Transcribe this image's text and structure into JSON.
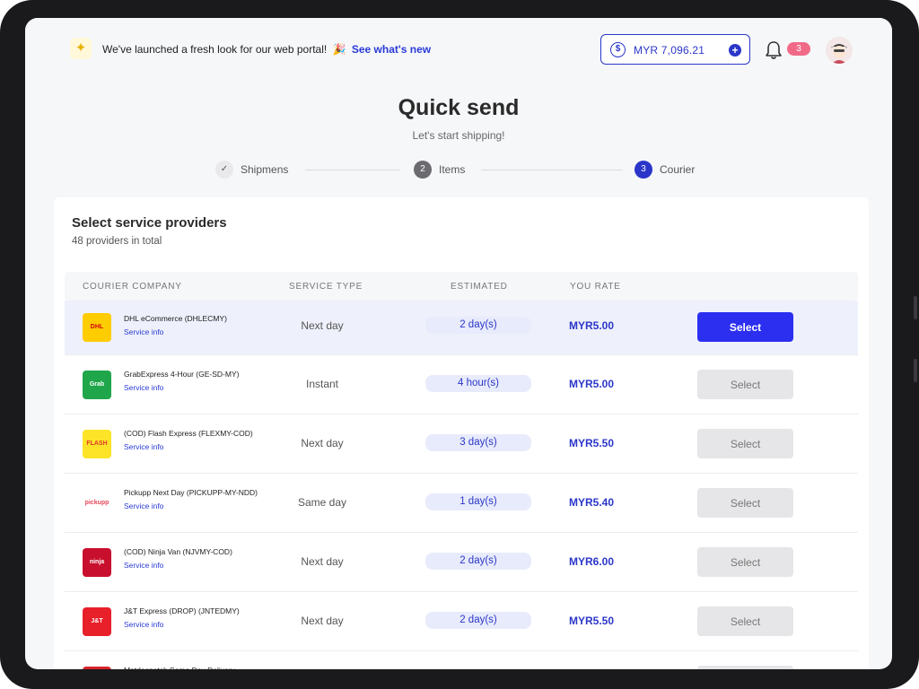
{
  "announcement": {
    "text": "We've launched a fresh look for our web portal!",
    "emoji": "🎉",
    "link": "See what's new"
  },
  "wallet": {
    "balance": "MYR 7,096.21"
  },
  "notifications": {
    "count": "3"
  },
  "page": {
    "title": "Quick send",
    "subtitle": "Let's start shipping!"
  },
  "steps": [
    {
      "label": "Shipmens",
      "marker": "✓",
      "state": "done"
    },
    {
      "label": "Items",
      "marker": "2",
      "state": "pending"
    },
    {
      "label": "Courier",
      "marker": "3",
      "state": "active"
    }
  ],
  "providers_card": {
    "title": "Select service providers",
    "count_text": "48 providers in total"
  },
  "table": {
    "headers": [
      "COURIER COMPANY",
      "SERVICE TYPE",
      "ESTIMATED",
      "YOU RATE"
    ],
    "service_info_label": "Service info",
    "select_label": "Select",
    "rows": [
      {
        "name": "DHL eCommerce (DHLECMY)",
        "logo_text": "DHL",
        "logo_bg": "#ffcc00",
        "logo_fg": "#d40511",
        "service": "Next day",
        "estimated": "2 day(s)",
        "rate": "MYR5.00",
        "selected": true
      },
      {
        "name": "GrabExpress 4-Hour (GE-SD-MY)",
        "logo_text": "Grab Express",
        "logo_bg": "#1fa64a",
        "logo_fg": "#ffffff",
        "service": "Instant",
        "estimated": "4 hour(s)",
        "rate": "MYR5.00",
        "selected": false
      },
      {
        "name": "(COD) Flash Express (FLEXMY-COD)",
        "logo_text": "FLASH",
        "logo_bg": "#fde428",
        "logo_fg": "#e03a2a",
        "service": "Next day",
        "estimated": "3 day(s)",
        "rate": "MYR5.50",
        "selected": false
      },
      {
        "name": "Pickupp Next Day (PICKUPP-MY-NDD)",
        "logo_text": "pickupp",
        "logo_bg": "#ffffff",
        "logo_fg": "#e5495b",
        "service": "Same day",
        "estimated": "1 day(s)",
        "rate": "MYR5.40",
        "selected": false
      },
      {
        "name": "(COD) Ninja Van (NJVMY-COD)",
        "logo_text": "ninja",
        "logo_bg": "#c8102e",
        "logo_fg": "#ffffff",
        "service": "Next day",
        "estimated": "2 day(s)",
        "rate": "MYR6.00",
        "selected": false
      },
      {
        "name": "J&T Express (DROP) (JNTEDMY)",
        "logo_text": "J&T",
        "logo_bg": "#e8202a",
        "logo_fg": "#ffffff",
        "service": "Next day",
        "estimated": "2 day(s)",
        "rate": "MYR5.50",
        "selected": false
      },
      {
        "name": "Matdespatch Same Day Delivery",
        "logo_text": "",
        "logo_bg": "#d8232a",
        "logo_fg": "#ffffff",
        "service": "",
        "estimated": "",
        "rate": "",
        "selected": false
      }
    ]
  },
  "colors": {
    "accent": "#2b36c9",
    "select_active": "#2c2ff0",
    "badge": "#f06a88"
  }
}
